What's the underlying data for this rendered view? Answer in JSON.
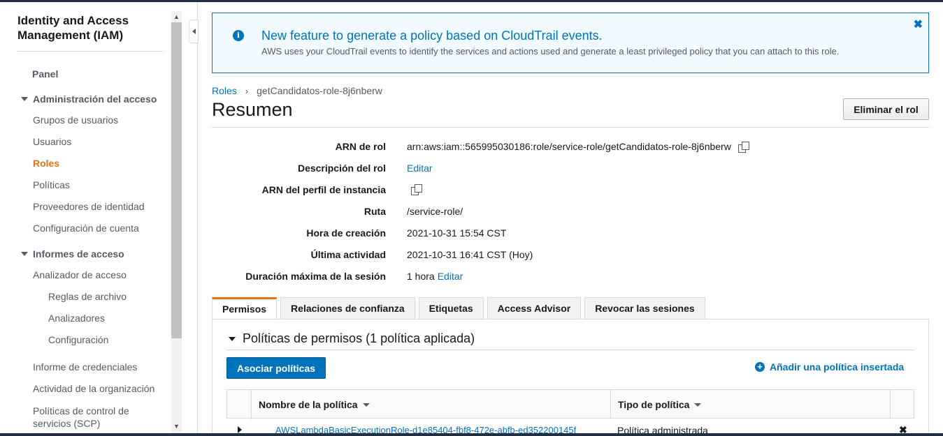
{
  "sidebar": {
    "title": "Identity and Access Management (IAM)",
    "panel": "Panel",
    "sections": [
      {
        "label": "Administración del acceso"
      },
      {
        "label": "Informes de acceso"
      }
    ],
    "access_items": [
      "Grupos de usuarios",
      "Usuarios",
      "Roles",
      "Políticas",
      "Proveedores de identidad",
      "Configuración de cuenta"
    ],
    "reports_items": [
      "Analizador de acceso",
      "Reglas de archivo",
      "Analizadores",
      "Configuración",
      "Informe de credenciales",
      "Actividad de la organización",
      "Políticas de control de servicios (SCP)"
    ],
    "active_item": "Roles"
  },
  "banner": {
    "title": "New feature to generate a policy based on CloudTrail events.",
    "text": "AWS uses your CloudTrail events to identify the services and actions used and generate a least privileged policy that you can attach to this role.",
    "close": "✖"
  },
  "breadcrumb": {
    "root": "Roles",
    "separator": "›",
    "current": "getCandidatos-role-8j6nberw"
  },
  "page": {
    "title": "Resumen",
    "delete_button": "Eliminar el rol"
  },
  "summary": {
    "arn_label": "ARN de rol",
    "arn_value": "arn:aws:iam::565995030186:role/service-role/getCandidatos-role-8j6nberw",
    "description_label": "Descripción del rol",
    "description_link": "Editar",
    "instance_profile_label": "ARN del perfil de instancia",
    "path_label": "Ruta",
    "path_value": "/service-role/",
    "created_label": "Hora de creación",
    "created_value": "2021-10-31 15:54 CST",
    "last_activity_label": "Última actividad",
    "last_activity_value": "2021-10-31 16:41 CST (Hoy)",
    "max_session_label": "Duración máxima de la sesión",
    "max_session_value": "1 hora",
    "max_session_link": "Editar"
  },
  "tabs": [
    "Permisos",
    "Relaciones de confianza",
    "Etiquetas",
    "Access Advisor",
    "Revocar las sesiones"
  ],
  "permissions": {
    "section_title": "Políticas de permisos (1 política aplicada)",
    "attach_button": "Asociar políticas",
    "add_inline": "Añadir una política insertada",
    "columns": [
      "Nombre de la política",
      "Tipo de política"
    ],
    "rows": [
      {
        "name": "AWSLambdaBasicExecutionRole-d1e85404-fbf8-472e-abfb-ed352200145f",
        "type": "Política administrada",
        "remove": "✖"
      }
    ]
  },
  "colors": {
    "accent": "#ec7211",
    "link": "#0073bb",
    "primary_button": "#0073bb"
  }
}
